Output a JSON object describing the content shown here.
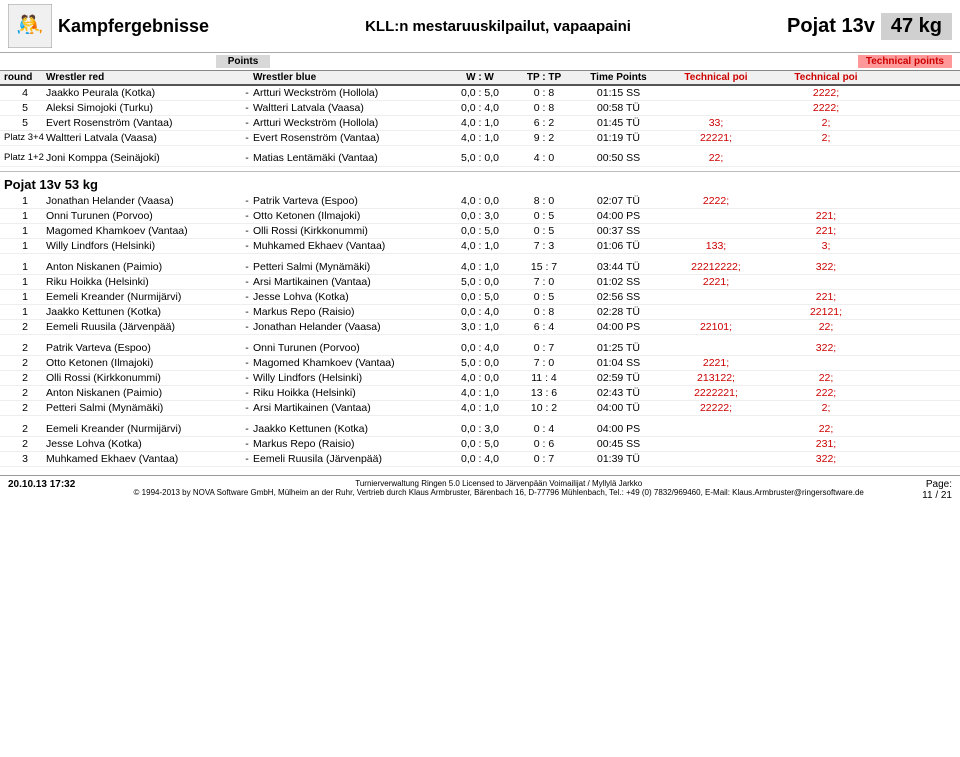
{
  "header": {
    "brand": "Kampfergebnisse",
    "subtitle": "KLL:n mestaruuskilpailut, vapaapaini",
    "category": "Pojat 13v",
    "weight": "47 kg",
    "points_label": "Points",
    "tech_points_label": "Technical points",
    "col_round": "round",
    "col_red": "Wrestler red",
    "col_dash": "-",
    "col_blue": "Wrestler blue",
    "col_w": "W : W",
    "col_tp": "TP : TP",
    "col_time": "Time Points",
    "col_tech1": "Technical poi",
    "col_tech2": "Technical poi"
  },
  "sections": [
    {
      "type": "matches",
      "rows": [
        {
          "round": "4",
          "red": "Jaakko Peurala (Kotka)",
          "blue": "Artturi Weckström (Hollola)",
          "w": "0,0 : 5,0",
          "tp": "0 : 8",
          "time": "01:15 SS",
          "tech1": "",
          "tech2": "2222;"
        },
        {
          "round": "5",
          "red": "Aleksi Simojoki (Turku)",
          "blue": "Waltteri Latvala (Vaasa)",
          "w": "0,0 : 4,0",
          "tp": "0 : 8",
          "time": "00:58 TÜ",
          "tech1": "",
          "tech2": "2222;"
        },
        {
          "round": "5",
          "red": "Evert Rosenström (Vantaa)",
          "blue": "Artturi Weckström (Hollola)",
          "w": "4,0 : 1,0",
          "tp": "6 : 2",
          "time": "01:45 TÜ",
          "tech1": "33;",
          "tech2": "2;"
        },
        {
          "round": "Platz 3+4",
          "red": "Waltteri Latvala (Vaasa)",
          "blue": "Evert Rosenström (Vantaa)",
          "w": "4,0 : 1,0",
          "tp": "9 : 2",
          "time": "01:19 TÜ",
          "tech1": "22221;",
          "tech2": "2;"
        }
      ]
    },
    {
      "type": "platz",
      "label": "Platz 1+2  Joni Komppa (Seinäjoki)  -  Matias Lentämäki (Vantaa)   5,0 : 0,0   4 : 0   00:50 SS   22;"
    },
    {
      "type": "section_header",
      "label": "Pojat 13v 53 kg"
    },
    {
      "type": "matches2",
      "rows": [
        {
          "round": "1",
          "red": "Jonathan Helander (Vaasa)",
          "blue": "Patrik Varteva (Espoo)",
          "w": "4,0 : 0,0",
          "tp": "8 : 0",
          "time": "02:07 TÜ",
          "tech1": "2222;",
          "tech2": ""
        },
        {
          "round": "1",
          "red": "Onni Turunen (Porvoo)",
          "blue": "Otto Ketonen (Ilmajoki)",
          "w": "0,0 : 3,0",
          "tp": "0 : 5",
          "time": "04:00 PS",
          "tech1": "",
          "tech2": "221;"
        },
        {
          "round": "1",
          "red": "Magomed Khamkoev (Vantaa)",
          "blue": "Olli Rossi (Kirkkonummi)",
          "w": "0,0 : 5,0",
          "tp": "0 : 5",
          "time": "00:37 SS",
          "tech1": "",
          "tech2": "221;"
        },
        {
          "round": "1",
          "red": "Willy Lindfors (Helsinki)",
          "blue": "Muhkamed Ekhaev (Vantaa)",
          "w": "4,0 : 1,0",
          "tp": "7 : 3",
          "time": "01:06 TÜ",
          "tech1": "133;",
          "tech2": "3;"
        },
        {
          "round": "",
          "red": "",
          "blue": "",
          "w": "",
          "tp": "",
          "time": "",
          "tech1": "",
          "tech2": ""
        },
        {
          "round": "1",
          "red": "Anton Niskanen (Paimio)",
          "blue": "Petteri Salmi (Mynämäki)",
          "w": "4,0 : 1,0",
          "tp": "15 : 7",
          "time": "03:44 TÜ",
          "tech1": "22212222;",
          "tech2": "322;"
        },
        {
          "round": "1",
          "red": "Riku Hoikka (Helsinki)",
          "blue": "Arsi Martikainen (Vantaa)",
          "w": "5,0 : 0,0",
          "tp": "7 : 0",
          "time": "01:02 SS",
          "tech1": "2221;",
          "tech2": ""
        },
        {
          "round": "1",
          "red": "Eemeli Kreander (Nurmijärvi)",
          "blue": "Jesse Lohva (Kotka)",
          "w": "0,0 : 5,0",
          "tp": "0 : 5",
          "time": "02:56 SS",
          "tech1": "",
          "tech2": "221;"
        },
        {
          "round": "1",
          "red": "Jaakko Kettunen (Kotka)",
          "blue": "Markus Repo (Raisio)",
          "w": "0,0 : 4,0",
          "tp": "0 : 8",
          "time": "02:28 TÜ",
          "tech1": "",
          "tech2": "22121;"
        },
        {
          "round": "2",
          "red": "Eemeli Ruusila (Järvenpää)",
          "blue": "Jonathan Helander (Vaasa)",
          "w": "3,0 : 1,0",
          "tp": "6 : 4",
          "time": "04:00 PS",
          "tech1": "22101;",
          "tech2": "22;"
        },
        {
          "round": "",
          "red": "",
          "blue": "",
          "w": "",
          "tp": "",
          "time": "",
          "tech1": "",
          "tech2": ""
        },
        {
          "round": "2",
          "red": "Patrik Varteva (Espoo)",
          "blue": "Onni Turunen (Porvoo)",
          "w": "0,0 : 4,0",
          "tp": "0 : 7",
          "time": "01:25 TÜ",
          "tech1": "",
          "tech2": "322;"
        },
        {
          "round": "2",
          "red": "Otto Ketonen (Ilmajoki)",
          "blue": "Magomed Khamkoev (Vantaa)",
          "w": "5,0 : 0,0",
          "tp": "7 : 0",
          "time": "01:04 SS",
          "tech1": "2221;",
          "tech2": ""
        },
        {
          "round": "2",
          "red": "Olli Rossi (Kirkkonummi)",
          "blue": "Willy Lindfors (Helsinki)",
          "w": "4,0 : 0,0",
          "tp": "11 : 4",
          "time": "02:59 TÜ",
          "tech1": "213122;",
          "tech2": "22;"
        },
        {
          "round": "2",
          "red": "Anton Niskanen (Paimio)",
          "blue": "Riku Hoikka (Helsinki)",
          "w": "4,0 : 1,0",
          "tp": "13 : 6",
          "time": "02:43 TÜ",
          "tech1": "2222221;",
          "tech2": "222;"
        },
        {
          "round": "2",
          "red": "Petteri Salmi (Mynämäki)",
          "blue": "Arsi Martikainen (Vantaa)",
          "w": "4,0 : 1,0",
          "tp": "10 : 2",
          "time": "04:00 TÜ",
          "tech1": "22222;",
          "tech2": "2;"
        },
        {
          "round": "",
          "red": "",
          "blue": "",
          "w": "",
          "tp": "",
          "time": "",
          "tech1": "",
          "tech2": ""
        },
        {
          "round": "2",
          "red": "Eemeli Kreander (Nurmijärvi)",
          "blue": "Jaakko Kettunen (Kotka)",
          "w": "0,0 : 3,0",
          "tp": "0 : 4",
          "time": "04:00 PS",
          "tech1": "",
          "tech2": "22;"
        },
        {
          "round": "2",
          "red": "Jesse Lohva (Kotka)",
          "blue": "Markus Repo (Raisio)",
          "w": "0,0 : 5,0",
          "tp": "0 : 6",
          "time": "00:45 SS",
          "tech1": "",
          "tech2": "231;"
        },
        {
          "round": "3",
          "red": "Muhkamed Ekhaev (Vantaa)",
          "blue": "Eemeli Ruusila (Järvenpää)",
          "w": "0,0 : 4,0",
          "tp": "0 : 7",
          "time": "01:39 TÜ",
          "tech1": "",
          "tech2": "322;"
        }
      ]
    }
  ],
  "footer": {
    "datetime": "20.10.13 17:32",
    "copyright": "© 1994-2013 by NOVA Software GmbH, Mülheim an der Ruhr, Vertrieb durch Klaus Armbruster, Bärenbach 16, D-77796 Mühlenbach, Tel.: +49 (0) 7832/969460, E-Mail: Klaus.Armbruster@ringersoftware.de",
    "license": "Turnierverwaltung Ringen 5.0 Licensed to Järvenpään Voimailijat / Myllylä Jarkko",
    "page": "Page:",
    "page_num": "11 / 21"
  }
}
